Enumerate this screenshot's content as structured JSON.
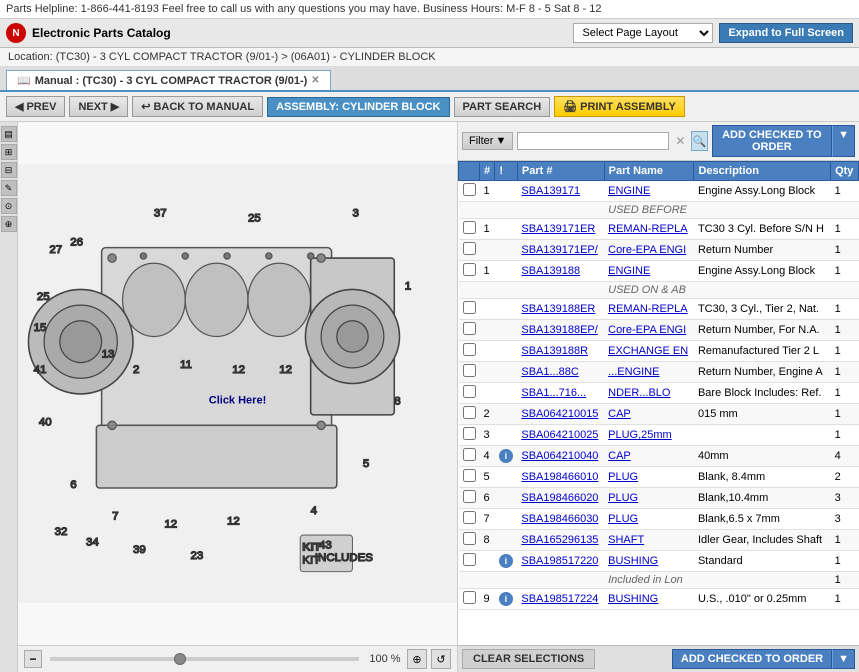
{
  "helpline": {
    "text": "Parts Helpline: 1-866-441-8193 Feel free to call us with any questions you may have. Business Hours: M-F 8 - 5 Sat 8 - 12"
  },
  "header": {
    "app_title": "Electronic Parts Catalog",
    "page_layout_label": "Select Page Layout",
    "expand_btn": "Expand to Full Screen"
  },
  "location": {
    "text": "Location: (TC30) - 3 CYL COMPACT TRACTOR (9/01-) > (06A01) - CYLINDER BLOCK"
  },
  "tab": {
    "label": "Manual : (TC30) - 3 CYL COMPACT TRACTOR (9/01-)"
  },
  "toolbar": {
    "prev": "PREV",
    "next": "NEXT",
    "back_to_manual": "BACK TO MANUAL",
    "assembly": "ASSEMBLY: CYLINDER BLOCK",
    "part_search": "PART SEARCH",
    "print_assembly": "PRINT ASSEMBLY"
  },
  "filter": {
    "label": "Filter",
    "placeholder": "",
    "add_checked": "ADD CHECKED TO ORDER"
  },
  "table": {
    "headers": [
      "",
      "#",
      "!",
      "Part #",
      "Part Name",
      "Description",
      "Qty"
    ],
    "rows": [
      {
        "id": 1,
        "num": "1",
        "info": false,
        "part": "SBA139171",
        "name": "ENGINE",
        "desc": "Engine Assy.Long Block",
        "qty": "1",
        "even": false
      },
      {
        "id": 2,
        "num": "",
        "info": false,
        "part": "",
        "name": "USED BEFORE",
        "desc": "",
        "qty": "",
        "even": true
      },
      {
        "id": 3,
        "num": "1",
        "info": false,
        "part": "SBA139171ER",
        "name": "REMAN-REPLA",
        "desc": "TC30 3 Cyl. Before S/N H",
        "qty": "1",
        "even": false
      },
      {
        "id": 4,
        "num": "",
        "info": false,
        "part": "SBA139171EP/",
        "name": "Core-EPA ENGI",
        "desc": "Return Number",
        "qty": "1",
        "even": true
      },
      {
        "id": 5,
        "num": "1",
        "info": false,
        "part": "SBA139188",
        "name": "ENGINE",
        "desc": "Engine Assy.Long Block",
        "qty": "1",
        "even": false
      },
      {
        "id": 6,
        "num": "",
        "info": false,
        "part": "",
        "name": "USED ON & AB",
        "desc": "",
        "qty": "",
        "even": true
      },
      {
        "id": 7,
        "num": "",
        "info": false,
        "part": "SBA139188ER",
        "name": "REMAN-REPLA",
        "desc": "TC30, 3 Cyl., Tier 2, Nat.",
        "qty": "1",
        "even": false
      },
      {
        "id": 8,
        "num": "",
        "info": false,
        "part": "SBA139188EP/",
        "name": "Core-EPA ENGI",
        "desc": "Return Number, For N.A.",
        "qty": "1",
        "even": true
      },
      {
        "id": 9,
        "num": "",
        "info": false,
        "part": "SBA139188R",
        "name": "EXCHANGE EN",
        "desc": "Remanufactured Tier 2 L",
        "qty": "1",
        "even": false
      },
      {
        "id": 10,
        "num": "",
        "info": false,
        "part": "SBA1...88C",
        "name": "...ENGINE",
        "desc": "Return Number, Engine A",
        "qty": "1",
        "even": true
      },
      {
        "id": 11,
        "num": "",
        "info": false,
        "part": "SBA1...716...",
        "name": "NDER...BLO",
        "desc": "Bare Block Includes: Ref.",
        "qty": "1",
        "even": false
      },
      {
        "id": 12,
        "num": "2",
        "info": false,
        "part": "SBA064210015",
        "name": "CAP",
        "desc": "015 mm",
        "qty": "1",
        "even": true
      },
      {
        "id": 13,
        "num": "3",
        "info": false,
        "part": "SBA064210025",
        "name": "PLUG,25mm",
        "desc": "",
        "qty": "1",
        "even": false
      },
      {
        "id": 14,
        "num": "4",
        "info": true,
        "part": "SBA064210040",
        "name": "CAP",
        "desc": "40mm",
        "qty": "4",
        "even": true
      },
      {
        "id": 15,
        "num": "5",
        "info": false,
        "part": "SBA198466010",
        "name": "PLUG",
        "desc": "Blank, 8.4mm",
        "qty": "2",
        "even": false
      },
      {
        "id": 16,
        "num": "6",
        "info": false,
        "part": "SBA198466020",
        "name": "PLUG",
        "desc": "Blank,10.4mm",
        "qty": "3",
        "even": true
      },
      {
        "id": 17,
        "num": "7",
        "info": false,
        "part": "SBA198466030",
        "name": "PLUG",
        "desc": "Blank,6.5 x 7mm",
        "qty": "3",
        "even": false
      },
      {
        "id": 18,
        "num": "8",
        "info": false,
        "part": "SBA165296135",
        "name": "SHAFT",
        "desc": "Idler Gear, Includes Shaft",
        "qty": "1",
        "even": true
      },
      {
        "id": 19,
        "num": "",
        "info": true,
        "part": "SBA198517220",
        "name": "BUSHING",
        "desc": "Standard",
        "qty": "1",
        "even": false
      },
      {
        "id": 20,
        "num": "",
        "info": false,
        "part": "",
        "name": "Included in Lon",
        "desc": "",
        "qty": "1",
        "even": true
      },
      {
        "id": 21,
        "num": "9",
        "info": true,
        "part": "SBA198517224",
        "name": "BUSHING",
        "desc": "U.S., .010\" or 0.25mm",
        "qty": "1",
        "even": false
      }
    ]
  },
  "zoom": {
    "percent": "100 %"
  },
  "bottom": {
    "clear": "CLEAR SELECTIONS",
    "add_checked": "ADD CHECKED TO ORDER"
  },
  "diagram": {
    "overlay": "Click Here!"
  }
}
